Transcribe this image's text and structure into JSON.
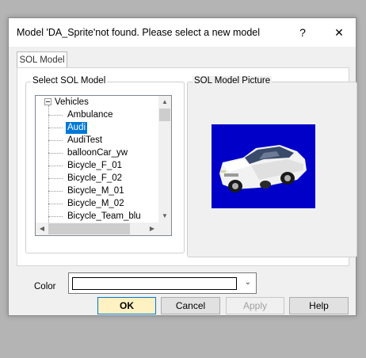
{
  "dialog": {
    "title": "Model 'DA_Sprite'not found.  Please select a new model",
    "help_glyph": "?",
    "close_glyph": "✕"
  },
  "tabs": [
    {
      "label": "SOL Model"
    }
  ],
  "model_group": {
    "label": "Select SOL Model",
    "root": "Vehicles",
    "items": [
      {
        "label": "Ambulance"
      },
      {
        "label": "Audi",
        "selected": true
      },
      {
        "label": "AudiTest"
      },
      {
        "label": "balloonCar_yw"
      },
      {
        "label": "Bicycle_F_01"
      },
      {
        "label": "Bicycle_F_02"
      },
      {
        "label": "Bicycle_M_01"
      },
      {
        "label": "Bicycle_M_02"
      },
      {
        "label": "Bicycle_Team_blu"
      }
    ]
  },
  "picture_group": {
    "label": "SOL Model Picture"
  },
  "color": {
    "label": "Color",
    "value": ""
  },
  "buttons": {
    "ok": "OK",
    "cancel": "Cancel",
    "apply": "Apply",
    "help": "Help"
  },
  "scroll_glyphs": {
    "up": "▲",
    "down": "▼",
    "left": "◀",
    "right": "▶",
    "combo": "⌄"
  },
  "colors": {
    "selection": "#0078d7",
    "picture_bg": "#0000c8",
    "default_button": "#fff1c2"
  }
}
